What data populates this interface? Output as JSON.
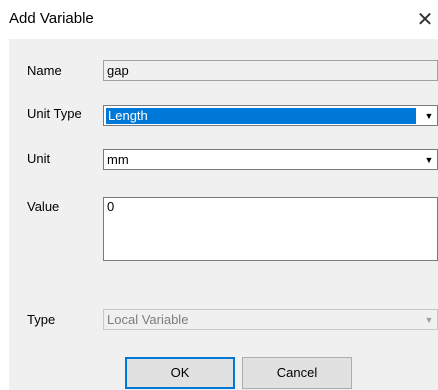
{
  "window": {
    "title": "Add Variable",
    "close_glyph": "✕"
  },
  "form": {
    "name": {
      "label": "Name",
      "value": "gap"
    },
    "unit_type": {
      "label": "Unit Type",
      "value": "Length"
    },
    "unit": {
      "label": "Unit",
      "value": "mm"
    },
    "value": {
      "label": "Value",
      "value": "0"
    },
    "type": {
      "label": "Type",
      "value": "Local Variable"
    }
  },
  "buttons": {
    "ok": "OK",
    "cancel": "Cancel"
  },
  "icons": {
    "close": "close-icon",
    "dropdown": "chevron-down-icon"
  },
  "colors": {
    "selection": "#0078d7",
    "dialog_bg": "#f0f0f0"
  }
}
